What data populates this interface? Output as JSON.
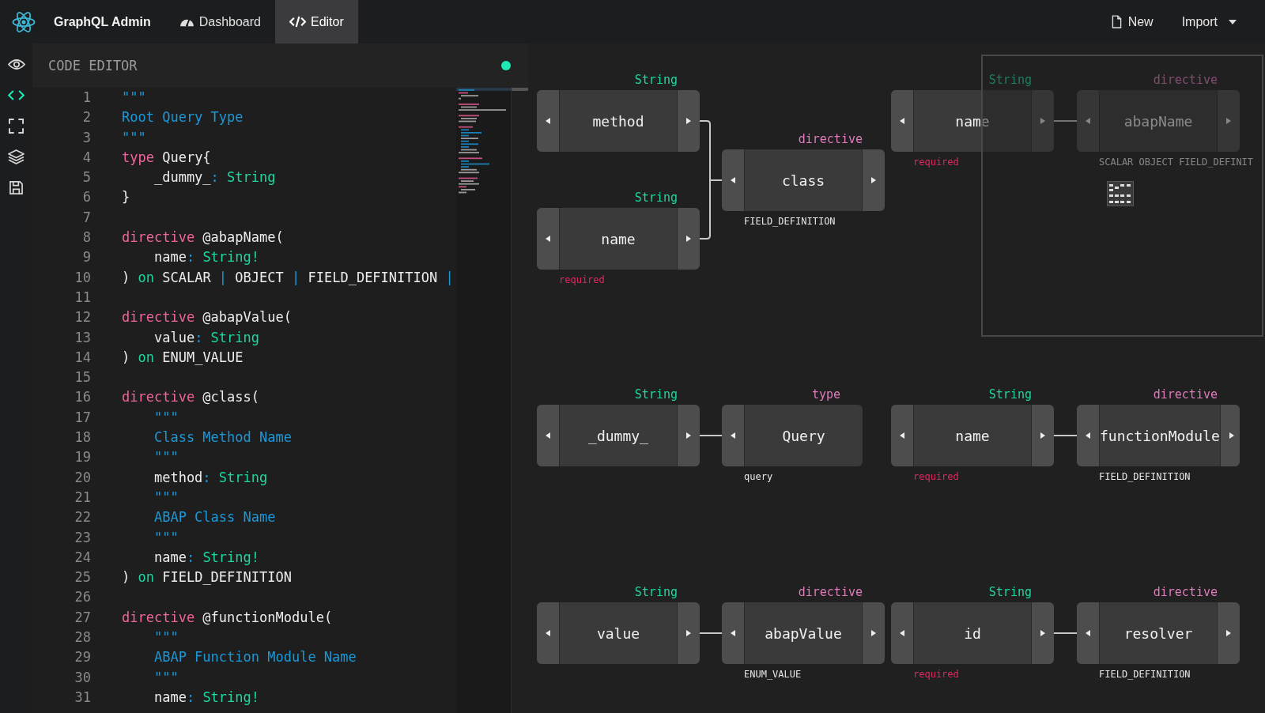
{
  "app": {
    "title": "GraphQL Admin"
  },
  "nav": [
    {
      "label": "Dashboard",
      "kind": "gauge",
      "selected": false
    },
    {
      "label": "Editor",
      "kind": "code",
      "selected": true
    }
  ],
  "actions": [
    {
      "label": "New",
      "kind": "new"
    },
    {
      "label": "Import",
      "kind": "dropdown"
    }
  ],
  "sidebar": {
    "items": [
      {
        "kind": "view",
        "selected": false
      },
      {
        "kind": "code",
        "selected": true
      },
      {
        "kind": "expand",
        "selected": false
      },
      {
        "kind": "layers",
        "selected": false
      },
      {
        "kind": "save",
        "selected": false
      }
    ]
  },
  "editor": {
    "title": "CODE EDITOR",
    "lines": [
      {
        "number": "1",
        "tokens": [
          {
            "kind": "desc",
            "text": "\"\"\""
          }
        ]
      },
      {
        "number": "2",
        "tokens": [
          {
            "kind": "desc",
            "text": "Root Query Type"
          }
        ]
      },
      {
        "number": "3",
        "tokens": [
          {
            "kind": "desc",
            "text": "\"\"\""
          }
        ]
      },
      {
        "number": "4",
        "tokens": [
          {
            "kind": "kw",
            "text": "type"
          },
          {
            "kind": "text",
            "text": " Query{"
          }
        ]
      },
      {
        "number": "5",
        "tokens": [
          {
            "kind": "text",
            "text": "    _dummy_"
          },
          {
            "kind": "punct",
            "text": ":"
          },
          {
            "kind": "type",
            "text": " String"
          }
        ]
      },
      {
        "number": "6",
        "tokens": [
          {
            "kind": "text",
            "text": "}"
          }
        ]
      },
      {
        "number": "7"
      },
      {
        "number": "8",
        "tokens": [
          {
            "kind": "kw",
            "text": "directive"
          },
          {
            "kind": "text",
            "text": " @abapName("
          }
        ]
      },
      {
        "number": "9",
        "tokens": [
          {
            "kind": "text",
            "text": "    name"
          },
          {
            "kind": "punct",
            "text": ":"
          },
          {
            "kind": "type",
            "text": " String!"
          }
        ]
      },
      {
        "number": "10",
        "tokens": [
          {
            "kind": "text",
            "text": ")"
          },
          {
            "kind": "type",
            "text": " on"
          },
          {
            "kind": "text",
            "text": " SCALAR "
          },
          {
            "kind": "punct",
            "text": "|"
          },
          {
            "kind": "text",
            "text": " OBJECT "
          },
          {
            "kind": "punct",
            "text": "|"
          },
          {
            "kind": "text",
            "text": " FIELD_DEFINITION "
          },
          {
            "kind": "punct",
            "text": "|"
          }
        ]
      },
      {
        "number": "11"
      },
      {
        "number": "12",
        "tokens": [
          {
            "kind": "kw",
            "text": "directive"
          },
          {
            "kind": "text",
            "text": " @abapValue("
          }
        ]
      },
      {
        "number": "13",
        "tokens": [
          {
            "kind": "text",
            "text": "    value"
          },
          {
            "kind": "punct",
            "text": ":"
          },
          {
            "kind": "type",
            "text": " String"
          }
        ]
      },
      {
        "number": "14",
        "tokens": [
          {
            "kind": "text",
            "text": ")"
          },
          {
            "kind": "type",
            "text": " on"
          },
          {
            "kind": "text",
            "text": " ENUM_VALUE"
          }
        ]
      },
      {
        "number": "15"
      },
      {
        "number": "16",
        "tokens": [
          {
            "kind": "kw",
            "text": "directive"
          },
          {
            "kind": "text",
            "text": " @class("
          }
        ]
      },
      {
        "number": "17",
        "tokens": [
          {
            "kind": "desc",
            "text": "    \"\"\""
          }
        ]
      },
      {
        "number": "18",
        "tokens": [
          {
            "kind": "desc",
            "text": "    Class Method Name"
          }
        ]
      },
      {
        "number": "19",
        "tokens": [
          {
            "kind": "desc",
            "text": "    \"\"\""
          }
        ]
      },
      {
        "number": "20",
        "tokens": [
          {
            "kind": "text",
            "text": "    method"
          },
          {
            "kind": "punct",
            "text": ":"
          },
          {
            "kind": "type",
            "text": " String"
          }
        ]
      },
      {
        "number": "21",
        "tokens": [
          {
            "kind": "desc",
            "text": "    \"\"\""
          }
        ]
      },
      {
        "number": "22",
        "tokens": [
          {
            "kind": "desc",
            "text": "    ABAP Class Name"
          }
        ]
      },
      {
        "number": "23",
        "tokens": [
          {
            "kind": "desc",
            "text": "    \"\"\""
          }
        ]
      },
      {
        "number": "24",
        "tokens": [
          {
            "kind": "text",
            "text": "    name"
          },
          {
            "kind": "punct",
            "text": ":"
          },
          {
            "kind": "type",
            "text": " String!"
          }
        ]
      },
      {
        "number": "25",
        "tokens": [
          {
            "kind": "text",
            "text": ")"
          },
          {
            "kind": "type",
            "text": " on"
          },
          {
            "kind": "text",
            "text": " FIELD_DEFINITION"
          }
        ]
      },
      {
        "number": "26"
      },
      {
        "number": "27",
        "tokens": [
          {
            "kind": "kw",
            "text": "directive"
          },
          {
            "kind": "text",
            "text": " @functionModule("
          }
        ]
      },
      {
        "number": "28",
        "tokens": [
          {
            "kind": "desc",
            "text": "    \"\"\""
          }
        ]
      },
      {
        "number": "29",
        "tokens": [
          {
            "kind": "desc",
            "text": "    ABAP Function Module Name"
          }
        ]
      },
      {
        "number": "30",
        "tokens": [
          {
            "kind": "desc",
            "text": "    \"\"\""
          }
        ]
      },
      {
        "number": "31",
        "tokens": [
          {
            "kind": "text",
            "text": "    name"
          },
          {
            "kind": "punct",
            "text": ":"
          },
          {
            "kind": "type",
            "text": " String!"
          }
        ]
      }
    ]
  },
  "graph": {
    "nodes": [
      {
        "name": "method",
        "kind": "field",
        "tag": "String"
      },
      {
        "name": "name",
        "kind": "field",
        "tag": "String",
        "note": "required",
        "required": true
      },
      {
        "name": "class",
        "kind": "directive",
        "tag": "directive",
        "note": "FIELD_DEFINITION",
        "required": false
      },
      {
        "name": "name",
        "kind": "field",
        "tag": "String",
        "note": "required",
        "required": true
      },
      {
        "name": "abapName",
        "kind": "directive",
        "tag": "directive",
        "note": "SCALAR OBJECT FIELD_DEFINIT",
        "required": false
      },
      {
        "name": "_dummy_",
        "kind": "field",
        "tag": "String"
      },
      {
        "name": "Query",
        "kind": "type",
        "tag": "type",
        "note": "query",
        "required": false
      },
      {
        "name": "name",
        "kind": "field",
        "tag": "String",
        "note": "required",
        "required": true
      },
      {
        "name": "functionModule",
        "kind": "directive",
        "tag": "directive",
        "note": "FIELD_DEFINITION",
        "required": false
      },
      {
        "name": "value",
        "kind": "field",
        "tag": "String"
      },
      {
        "name": "abapValue",
        "kind": "directive",
        "tag": "directive",
        "note": "ENUM_VALUE",
        "required": false
      },
      {
        "name": "id",
        "kind": "field",
        "tag": "String",
        "note": "required",
        "required": true
      },
      {
        "name": "resolver",
        "kind": "directive",
        "tag": "directive",
        "note": "FIELD_DEFINITION",
        "required": false
      }
    ]
  }
}
